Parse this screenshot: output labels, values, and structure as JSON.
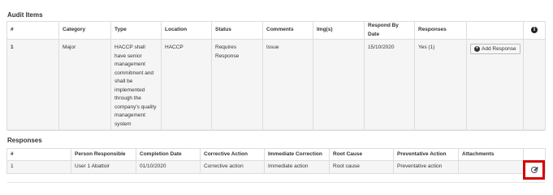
{
  "audit_items": {
    "title": "Audit Items",
    "headers": [
      "#",
      "Category",
      "Type",
      "Location",
      "Status",
      "Comments",
      "Img(s)",
      "Respond By Date",
      "Responses",
      "",
      ""
    ],
    "rows": [
      {
        "num": "1",
        "category": "Major",
        "type": "HACCP shall have senior management commitment and shall be implemented through the company's quality management system",
        "location": "HACCP",
        "status": "Requires Response",
        "comments": "Issue",
        "imgs": "",
        "respond_by": "15/10/2020",
        "responses": "Yes (1)",
        "add_response_label": "Add Response"
      }
    ],
    "info_icon_glyph": "i"
  },
  "responses": {
    "title": "Responses",
    "headers": [
      "#",
      "Person Responsible",
      "Completion Date",
      "Corrective Action",
      "Immediate Correction",
      "Root Cause",
      "Preventative Action",
      "Attachments",
      ""
    ],
    "rows": [
      {
        "num": "1",
        "person": "User 1 Abattoir",
        "completion_date": "01/10/2020",
        "corrective_action": "Corrective action",
        "immediate_correction": "Immediate action",
        "root_cause": "Root cause",
        "preventative_action": "Preventative action",
        "attachments": ""
      }
    ]
  },
  "colors": {
    "highlight": "#d40000",
    "stripe": "#f5f5f5",
    "border": "#dddddd"
  }
}
